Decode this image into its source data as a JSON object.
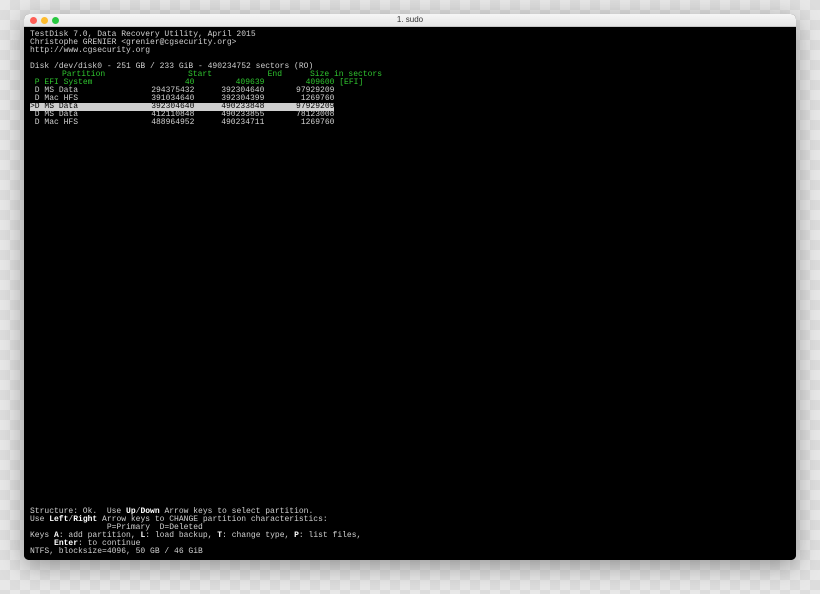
{
  "window": {
    "title": "1. sudo"
  },
  "header": {
    "line1": "TestDisk 7.0, Data Recovery Utility, April 2015",
    "line2": "Christophe GRENIER <grenier@cgsecurity.org>",
    "line3": "http://www.cgsecurity.org"
  },
  "disk": "Disk /dev/disk0 - 251 GB / 233 GiB - 490234752 sectors (RO)",
  "columns": {
    "partition": "Partition",
    "start": "Start",
    "end": "End",
    "size": "Size in sectors"
  },
  "efi": {
    "flag": " P",
    "name": "EFI System",
    "start": "40",
    "end": "409639",
    "size": "409600",
    "tag": "[EFI]"
  },
  "rows": [
    {
      "flag": " D",
      "name": "MS Data",
      "start": "294375432",
      "end": "392304640",
      "size": "97929209"
    },
    {
      "flag": " D",
      "name": "Mac HFS",
      "start": "391034640",
      "end": "392304399",
      "size": "1269760"
    },
    {
      "flag": ">D",
      "name": "MS Data",
      "start": "392304640",
      "end": "490233848",
      "size": "97929209",
      "selected": true
    },
    {
      "flag": " D",
      "name": "MS Data",
      "start": "412110848",
      "end": "490233855",
      "size": "78123008"
    },
    {
      "flag": " D",
      "name": "Mac HFS",
      "start": "488964952",
      "end": "490234711",
      "size": "1269760"
    }
  ],
  "footer": {
    "l1a": "Structure: Ok.  Use ",
    "l1b": "Up",
    "l1c": "/",
    "l1d": "Down",
    "l1e": " Arrow keys to select partition.",
    "l2a": "Use ",
    "l2b": "Left",
    "l2c": "/",
    "l2d": "Right",
    "l2e": " Arrow keys to CHANGE partition characteristics:",
    "l3": "                P=Primary  D=Deleted",
    "l4a": "Keys ",
    "l4b": "A",
    "l4c": ": add partition, ",
    "l4d": "L",
    "l4e": ": load backup, ",
    "l4f": "T",
    "l4g": ": change type, ",
    "l4h": "P",
    "l4i": ": list files,",
    "l5a": "     ",
    "l5b": "Enter",
    "l5c": ": to continue",
    "l6": "NTFS, blocksize=4096, 50 GB / 46 GiB"
  }
}
